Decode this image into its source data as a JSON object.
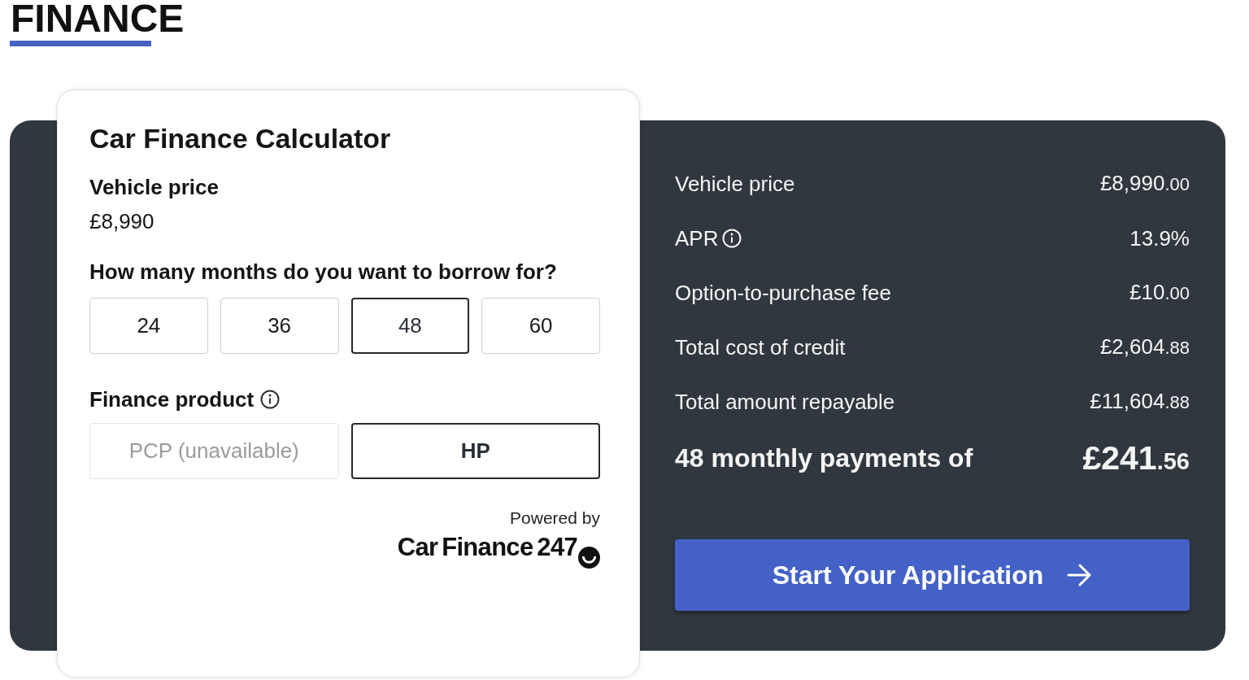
{
  "page": {
    "heading": "FINANCE"
  },
  "calculator": {
    "title": "Car Finance Calculator",
    "price_label": "Vehicle price",
    "price": "£8,990",
    "term_question": "How many months do you want to borrow for?",
    "terms": [
      {
        "label": "24",
        "selected": false
      },
      {
        "label": "36",
        "selected": false
      },
      {
        "label": "48",
        "selected": true
      },
      {
        "label": "60",
        "selected": false
      }
    ],
    "product_label": "Finance product",
    "products": [
      {
        "label": "PCP (unavailable)",
        "selected": false,
        "disabled": true
      },
      {
        "label": "HP",
        "selected": true,
        "disabled": false
      }
    ],
    "powered_by": "Powered by",
    "provider_logo": "Car Finance 247"
  },
  "summary": {
    "rows": [
      {
        "label": "Vehicle price",
        "amount": "£8,990",
        "pence": ".00",
        "info": false
      },
      {
        "label": "APR",
        "amount": "13.9%",
        "info": true
      },
      {
        "label": "Option-to-purchase fee",
        "amount": "£10",
        "pence": ".00",
        "info": false
      },
      {
        "label": "Total cost of credit",
        "amount": "£2,604",
        "pence": ".88",
        "info": false
      },
      {
        "label": "Total amount repayable",
        "amount": "£11,604",
        "pence": ".88",
        "info": false
      }
    ],
    "monthly": {
      "label": "48 monthly payments of",
      "amount": "£241",
      "pence": ".56"
    },
    "button": "Start Your Application"
  }
}
